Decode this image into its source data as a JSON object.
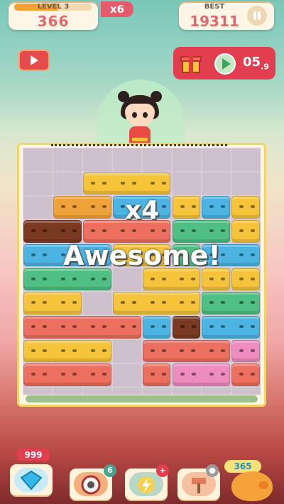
{
  "header": {
    "level_label": "LEVEL 3",
    "level_progress": 0.55,
    "score": "366",
    "multiplier": "x6",
    "best_label": "BEST",
    "best_value": "19311"
  },
  "reward": {
    "timer_main": "05",
    "timer_fraction": ".9"
  },
  "combo": {
    "multiplier_text": "x4",
    "message": "Awesome!"
  },
  "powerups": {
    "gems": "999",
    "bomb_count": "6",
    "lightning_badge": "+",
    "coins": "365"
  },
  "colors": {
    "yellow": "#f5c43a",
    "orange": "#f0a339",
    "blue": "#4cb4e3",
    "green": "#4fbf83",
    "red": "#ec6f5f",
    "pink": "#ee8bbf",
    "brown": "#7a3a22"
  },
  "icons": [
    "video-icon",
    "gift-icon",
    "play-icon",
    "pause-icon",
    "gem-icon",
    "bomb-icon",
    "lightning-icon",
    "hammer-icon",
    "piggy-bank-icon"
  ]
}
